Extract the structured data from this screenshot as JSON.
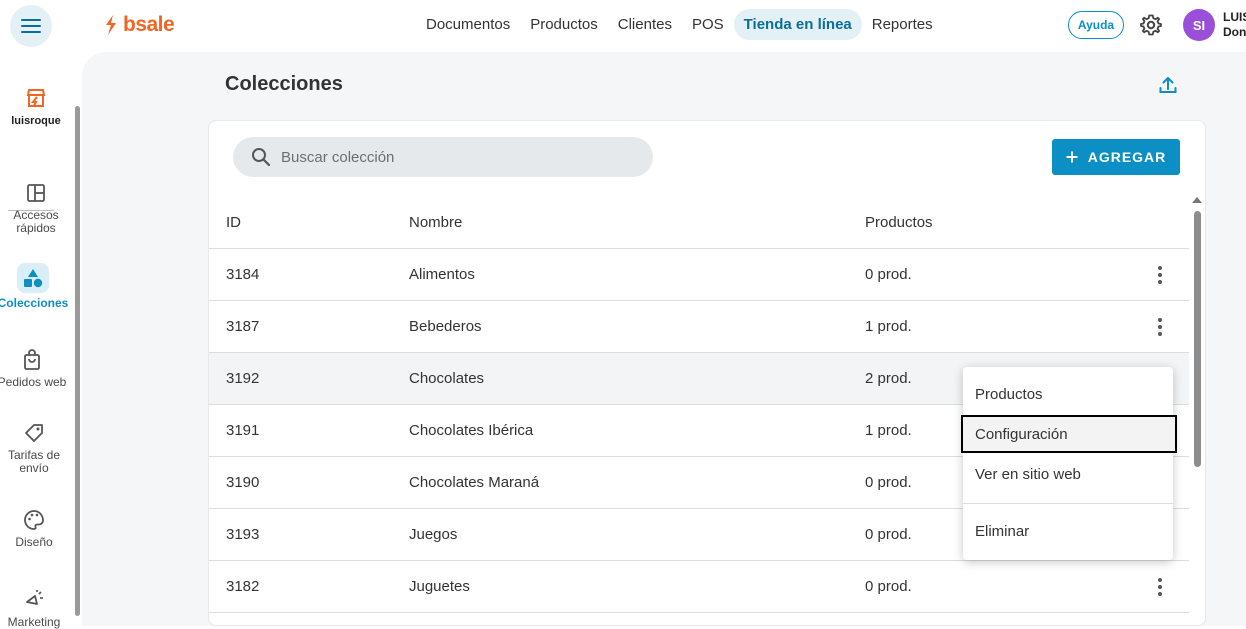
{
  "topbar": {
    "logo_text": "bsale",
    "nav": [
      "Documentos",
      "Productos",
      "Clientes",
      "POS",
      "Tienda en línea",
      "Reportes"
    ],
    "active_nav": "Tienda en línea",
    "help_label": "Ayuda",
    "avatar_initials": "SI",
    "user_line1": "LUIS",
    "user_line2": "Don"
  },
  "sidebar": {
    "store_name": "luisroque",
    "items": [
      {
        "label_l1": "Accesos",
        "label_l2": "rápidos"
      },
      {
        "label_l1": "Colecciones",
        "label_l2": ""
      },
      {
        "label_l1": "Pedidos web",
        "label_l2": ""
      },
      {
        "label_l1": "Tarifas de",
        "label_l2": "envío"
      },
      {
        "label_l1": "Diseño",
        "label_l2": ""
      },
      {
        "label_l1": "Marketing",
        "label_l2": ""
      }
    ]
  },
  "page": {
    "title": "Colecciones",
    "search_placeholder": "Buscar colección",
    "add_label": "AGREGAR"
  },
  "table": {
    "headers": {
      "id": "ID",
      "name": "Nombre",
      "products": "Productos"
    },
    "rows": [
      {
        "id": "3184",
        "name": "Alimentos",
        "products": "0 prod."
      },
      {
        "id": "3187",
        "name": "Bebederos",
        "products": "1 prod."
      },
      {
        "id": "3192",
        "name": "Chocolates",
        "products": "2 prod."
      },
      {
        "id": "3191",
        "name": "Chocolates Ibérica",
        "products": "1 prod."
      },
      {
        "id": "3190",
        "name": "Chocolates Maraná",
        "products": "0 prod."
      },
      {
        "id": "3193",
        "name": "Juegos",
        "products": "0 prod."
      },
      {
        "id": "3182",
        "name": "Juguetes",
        "products": "0 prod."
      }
    ]
  },
  "context_menu": {
    "items": [
      "Productos",
      "Configuración",
      "Ver en sitio web",
      "Eliminar"
    ],
    "focused": "Configuración"
  },
  "colors": {
    "accent": "#0b8fc4",
    "brand": "#f26522",
    "avatar": "#9a4fd8"
  }
}
